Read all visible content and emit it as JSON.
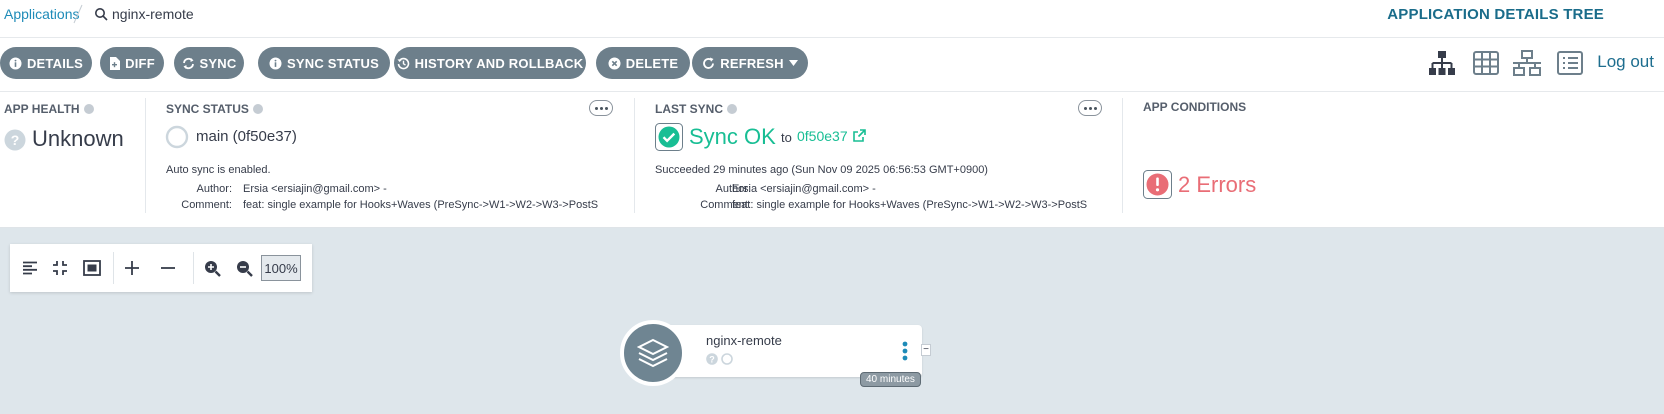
{
  "breadcrumb": {
    "applications": "Applications",
    "current": "nginx-remote"
  },
  "view_title": "APPLICATION DETAILS TREE",
  "toolbar": {
    "details": "DETAILS",
    "diff": "DIFF",
    "sync": "SYNC",
    "sync_status": "SYNC STATUS",
    "history": "HISTORY AND ROLLBACK",
    "delete": "DELETE",
    "refresh": "REFRESH",
    "logout": "Log out"
  },
  "app_health": {
    "title": "APP HEALTH",
    "status": "Unknown"
  },
  "sync_status": {
    "title": "SYNC STATUS",
    "revision": "main (0f50e37)",
    "auto_sync": "Auto sync is enabled.",
    "author_label": "Author:",
    "author": "Ersia <ersiajin@gmail.com> -",
    "comment_label": "Comment:",
    "comment": "feat: single example for Hooks+Waves (PreSync->W1->W2->W3->PostS"
  },
  "last_sync": {
    "title": "LAST SYNC",
    "status": "Sync OK",
    "to": "to",
    "revision": "0f50e37",
    "succeeded": "Succeeded 29 minutes ago (Sun Nov 09 2025 06:56:53 GMT+0900)",
    "author_label": "Author:",
    "author": "Ersia <ersiajin@gmail.com> -",
    "comment_label": "Comment:",
    "comment": "feat: single example for Hooks+Waves (PreSync->W1->W2->W3->PostS"
  },
  "app_conditions": {
    "title": "APP CONDITIONS",
    "errors": "2 Errors"
  },
  "zoom": {
    "level": "100%"
  },
  "node": {
    "name": "nginx-remote",
    "age": "40 minutes",
    "collapse": "−"
  },
  "colors": {
    "accent": "#1e8bb8",
    "button": "#6d7f8b",
    "sync_ok": "#18be94",
    "error": "#e96d76",
    "canvas": "#dee6eb"
  }
}
